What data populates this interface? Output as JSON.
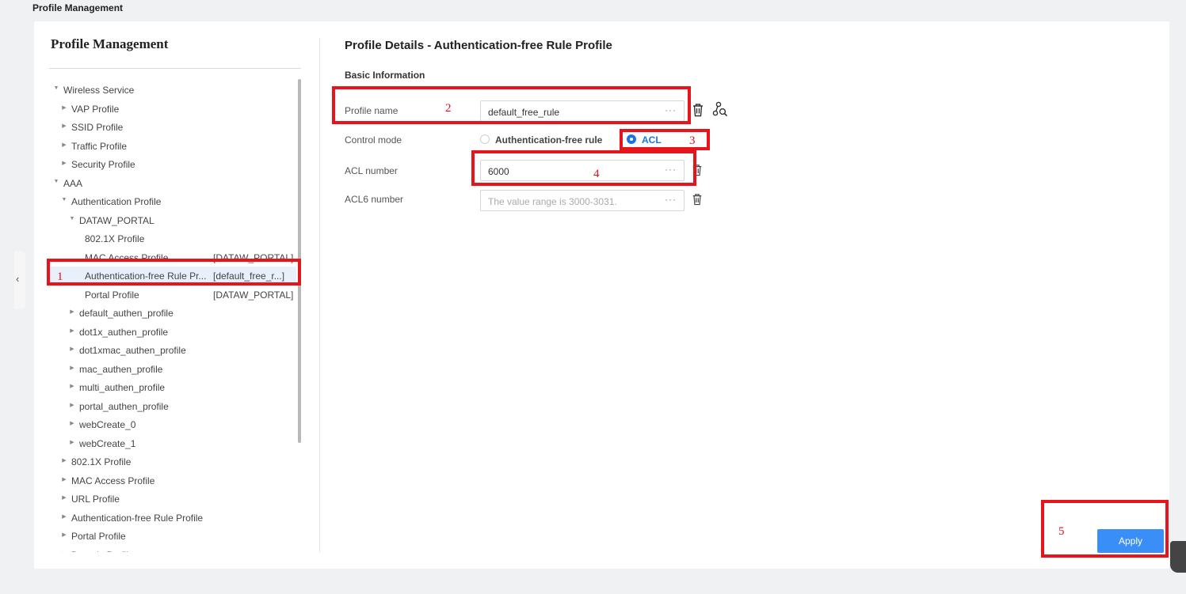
{
  "page": {
    "title": "Profile Management"
  },
  "left_panel": {
    "title": "Profile Management",
    "tree": [
      {
        "label": "Wireless Service",
        "caret": "▼",
        "tag": ""
      },
      {
        "label": "VAP Profile",
        "caret": "▶",
        "tag": ""
      },
      {
        "label": "SSID Profile",
        "caret": "▶",
        "tag": ""
      },
      {
        "label": "Traffic Profile",
        "caret": "▶",
        "tag": ""
      },
      {
        "label": "Security Profile",
        "caret": "▶",
        "tag": ""
      },
      {
        "label": "AAA",
        "caret": "▼",
        "tag": ""
      },
      {
        "label": "Authentication Profile",
        "caret": "▼",
        "tag": ""
      },
      {
        "label": "DATAW_PORTAL",
        "caret": "▼",
        "tag": ""
      },
      {
        "label": "802.1X Profile",
        "caret": "",
        "tag": ""
      },
      {
        "label": "MAC Access Profile",
        "caret": "",
        "tag": "[DATAW_PORTAL]"
      },
      {
        "label": "Authentication-free Rule Pr...",
        "caret": "",
        "tag": "[default_free_r...]"
      },
      {
        "label": "Portal Profile",
        "caret": "",
        "tag": "[DATAW_PORTAL]"
      },
      {
        "label": "default_authen_profile",
        "caret": "▶",
        "tag": ""
      },
      {
        "label": "dot1x_authen_profile",
        "caret": "▶",
        "tag": ""
      },
      {
        "label": "dot1xmac_authen_profile",
        "caret": "▶",
        "tag": ""
      },
      {
        "label": "mac_authen_profile",
        "caret": "▶",
        "tag": ""
      },
      {
        "label": "multi_authen_profile",
        "caret": "▶",
        "tag": ""
      },
      {
        "label": "portal_authen_profile",
        "caret": "▶",
        "tag": ""
      },
      {
        "label": "webCreate_0",
        "caret": "▶",
        "tag": ""
      },
      {
        "label": "webCreate_1",
        "caret": "▶",
        "tag": ""
      },
      {
        "label": "802.1X Profile",
        "caret": "▶",
        "tag": ""
      },
      {
        "label": "MAC Access Profile",
        "caret": "▶",
        "tag": ""
      },
      {
        "label": "URL Profile",
        "caret": "▶",
        "tag": ""
      },
      {
        "label": "Authentication-free Rule Profile",
        "caret": "▶",
        "tag": ""
      },
      {
        "label": "Portal Profile",
        "caret": "▶",
        "tag": ""
      },
      {
        "label": "Domain Profile",
        "caret": "▶",
        "tag": ""
      }
    ]
  },
  "details": {
    "title": "Profile Details - Authentication-free Rule Profile",
    "section": "Basic Information",
    "profile_name": {
      "label": "Profile name",
      "value": "default_free_rule"
    },
    "control_mode": {
      "label": "Control mode",
      "options": [
        "Authentication-free rule",
        "ACL"
      ],
      "selected": "ACL"
    },
    "acl_number": {
      "label": "ACL number",
      "value": "6000"
    },
    "acl6_number": {
      "label": "ACL6 number",
      "value": "",
      "placeholder": "The value range is 3000-3031."
    },
    "more_symbol": "···",
    "apply_label": "Apply"
  },
  "collapse_symbol": "‹",
  "annotations": [
    "1",
    "2",
    "3",
    "4",
    "5"
  ],
  "colors": {
    "accent": "#1a73e8",
    "button": "#3a8ef7",
    "annotation": "#e8141c"
  }
}
